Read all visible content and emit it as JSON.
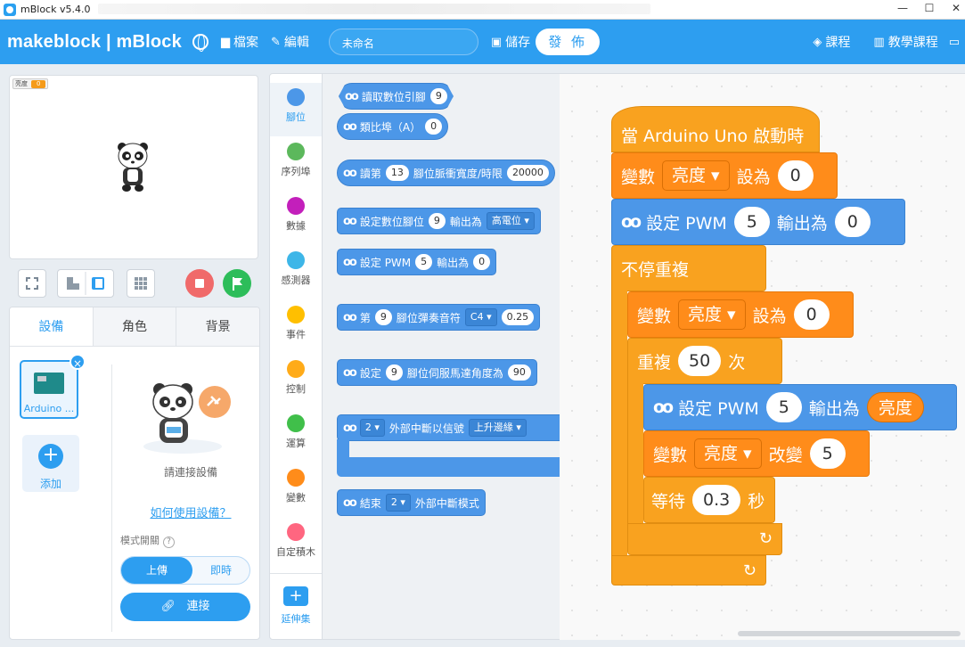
{
  "window": {
    "title": "mBlock v5.4.0"
  },
  "menubar": {
    "logo": "makeblock | mBlock",
    "file": "檔案",
    "edit": "編輯",
    "project_name": "未命名",
    "save": "儲存",
    "publish": "發 佈",
    "courses": "課程",
    "tutorials": "教學課程"
  },
  "stage": {
    "monitor_name": "亮度",
    "monitor_value": "0"
  },
  "device_panel": {
    "tabs": [
      "設備",
      "角色",
      "背景"
    ],
    "device_label": "Arduino ...",
    "add_label": "添加",
    "connect_hint": "請連接設備",
    "howto": "如何使用設備？",
    "mode_label": "模式開關",
    "mode_upload": "上傳",
    "mode_live": "即時",
    "connect": "連接"
  },
  "categories": [
    {
      "label": "腳位",
      "color": "#4c97e8"
    },
    {
      "label": "序列埠",
      "color": "#5cb85c"
    },
    {
      "label": "數據",
      "color": "#c31fbb"
    },
    {
      "label": "感測器",
      "color": "#3db6e8"
    },
    {
      "label": "事件",
      "color": "#ffbf00"
    },
    {
      "label": "控制",
      "color": "#ffab19"
    },
    {
      "label": "運算",
      "color": "#40bf4a"
    },
    {
      "label": "變數",
      "color": "#ff8c1a"
    },
    {
      "label": "自定積木",
      "color": "#ff6680"
    }
  ],
  "extensions": "延伸集",
  "palette": {
    "digital_read": "讀取數位引腳",
    "digital_read_pin": "9",
    "analog_read": "類比埠（A）",
    "analog_read_pin": "0",
    "pulse_a": "讀第",
    "pulse_pin": "13",
    "pulse_b": "腳位脈衝寬度/時限",
    "pulse_timeout": "20000",
    "set_digital": "設定數位腳位",
    "set_digital_pin": "9",
    "set_digital_out": "輸出為",
    "set_digital_level": "高電位 ▾",
    "set_pwm": "設定 PWM",
    "set_pwm_pin": "5",
    "set_pwm_out": "輸出為",
    "set_pwm_val": "0",
    "tone_a": "第",
    "tone_pin": "9",
    "tone_b": "腳位彈奏音符",
    "tone_note": "C4 ▾",
    "tone_beat": "0.25",
    "servo_a": "設定",
    "servo_pin": "9",
    "servo_b": "腳位伺服馬達角度為",
    "servo_angle": "90",
    "int_num": "2 ▾",
    "int_text": "外部中斷以信號",
    "int_mode": "上升邊緣 ▾",
    "end_a": "結束",
    "end_num": "2 ▾",
    "end_b": "外部中斷模式"
  },
  "script": {
    "hat": "當 Arduino Uno 啟動時",
    "set_var_a": "變數",
    "var_name": "亮度 ▾",
    "set_var_b": "設為",
    "set_var_val": "0",
    "pwm_a": "設定 PWM",
    "pwm_pin": "5",
    "pwm_b": "輸出為",
    "pwm_val": "0",
    "forever": "不停重複",
    "inner_set_a": "變數",
    "inner_var": "亮度 ▾",
    "inner_set_b": "設為",
    "inner_set_val": "0",
    "repeat_a": "重複",
    "repeat_n": "50",
    "repeat_b": "次",
    "pwm2_a": "設定 PWM",
    "pwm2_pin": "5",
    "pwm2_b": "輸出為",
    "pwm2_val": "亮度",
    "change_a": "變數",
    "change_var": "亮度 ▾",
    "change_b": "改變",
    "change_val": "5",
    "wait_a": "等待",
    "wait_val": "0.3",
    "wait_b": "秒",
    "arrow": "↻"
  }
}
